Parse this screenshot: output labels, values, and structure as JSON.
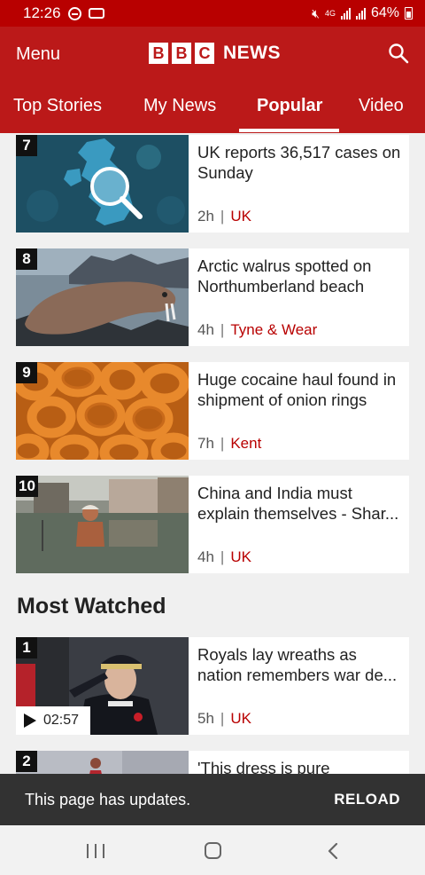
{
  "status_bar": {
    "time": "12:26",
    "network": "4G",
    "battery": "64%"
  },
  "header": {
    "menu_label": "Menu",
    "logo_letters": [
      "B",
      "B",
      "C"
    ],
    "logo_text": "NEWS",
    "brand_color": "#bb1919"
  },
  "tabs": [
    "Top Stories",
    "My News",
    "Popular",
    "Video"
  ],
  "active_tab": "Popular",
  "popular": [
    {
      "rank": "7",
      "title": "UK reports 36,517 cases on Sunday",
      "age": "2h",
      "tag": "UK"
    },
    {
      "rank": "8",
      "title": "Arctic walrus spotted on Northumberland beach",
      "age": "4h",
      "tag": "Tyne & Wear"
    },
    {
      "rank": "9",
      "title": "Huge cocaine haul found in shipment of onion rings",
      "age": "7h",
      "tag": "Kent"
    },
    {
      "rank": "10",
      "title": "China and India must explain themselves - Shar...",
      "age": "4h",
      "tag": "UK"
    }
  ],
  "most_watched": {
    "title": "Most Watched",
    "items": [
      {
        "rank": "1",
        "title": "Royals lay wreaths as nation remembers war de...",
        "age": "5h",
        "tag": "UK",
        "duration": "02:57"
      },
      {
        "rank": "2",
        "title": "'This dress is pure"
      }
    ]
  },
  "snackbar": {
    "message": "This page has updates.",
    "action": "RELOAD"
  }
}
